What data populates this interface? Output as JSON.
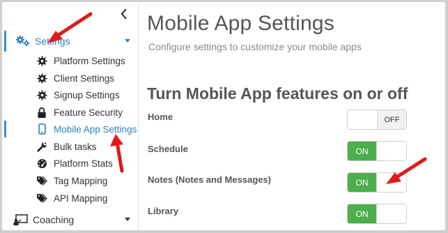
{
  "sidebar": {
    "collapse_icon": "chevron-left-icon",
    "settings": {
      "label": "Settings",
      "icon": "cogs-icon"
    },
    "items": [
      {
        "label": "Platform Settings",
        "icon": "gear-icon"
      },
      {
        "label": "Client Settings",
        "icon": "gear-icon"
      },
      {
        "label": "Signup Settings",
        "icon": "gear-icon"
      },
      {
        "label": "Feature Security",
        "icon": "lock-icon"
      },
      {
        "label": "Mobile App Settings",
        "icon": "mobile-icon",
        "active": true
      },
      {
        "label": "Bulk tasks",
        "icon": "wrench-icon"
      },
      {
        "label": "Platform Stats",
        "icon": "dashboard-icon"
      },
      {
        "label": "Tag Mapping",
        "icon": "tags-icon"
      },
      {
        "label": "API Mapping",
        "icon": "tags-icon"
      }
    ],
    "coaching": {
      "label": "Coaching",
      "icon": "presentation-icon"
    }
  },
  "main": {
    "title": "Mobile App Settings",
    "subtitle": "Configure settings to customize your mobile apps",
    "section_title": "Turn Mobile App features on or off",
    "features": [
      {
        "label": "Home",
        "state": "OFF"
      },
      {
        "label": "Schedule",
        "state": "ON"
      },
      {
        "label": "Notes (Notes and Messages)",
        "state": "ON"
      },
      {
        "label": "Library",
        "state": "ON"
      }
    ]
  },
  "colors": {
    "accent": "#2d7fc1",
    "toggle_on": "#4cae4c",
    "annotation_arrow": "#e0191c"
  }
}
